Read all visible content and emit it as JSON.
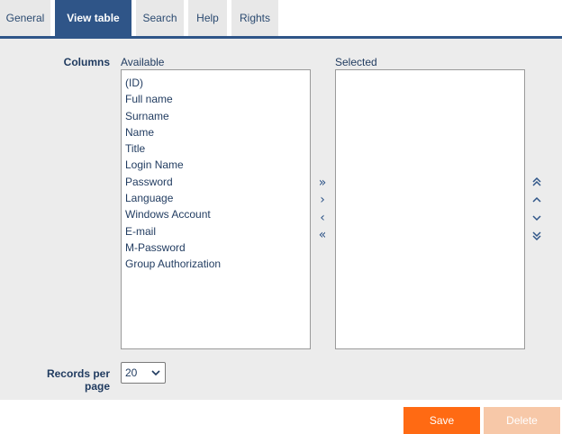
{
  "tabs": [
    {
      "label": "General"
    },
    {
      "label": "View table"
    },
    {
      "label": "Search"
    },
    {
      "label": "Help"
    },
    {
      "label": "Rights"
    }
  ],
  "columns": {
    "label": "Columns",
    "available_label": "Available",
    "selected_label": "Selected",
    "available_items": [
      "(ID)",
      "Full name",
      "Surname",
      "Name",
      "Title",
      "Login Name",
      "Password",
      "Language",
      "Windows Account",
      "E-mail",
      "M-Password",
      "Group Authorization"
    ],
    "selected_items": [],
    "transfer_icons": {
      "add_all": "»",
      "add": "›",
      "remove": "‹",
      "remove_all": "«"
    },
    "order_icons": {
      "top": "⏶",
      "up": "⌃",
      "down": "⌄",
      "bottom": "⏷"
    }
  },
  "records": {
    "label_line1": "Records per",
    "label_line2": "page",
    "value": "20"
  },
  "actions": {
    "save_label": "Save",
    "delete_label": "Delete"
  },
  "colors": {
    "accent": "#2f5588",
    "save": "#ff6a13",
    "delete_disabled": "#f7c8a8"
  }
}
